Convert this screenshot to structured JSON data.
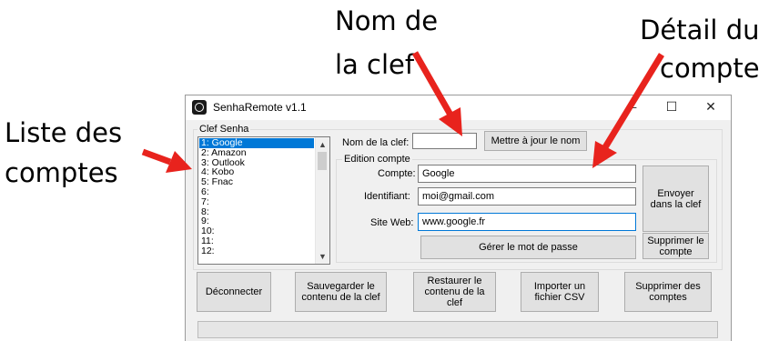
{
  "callouts": {
    "key_name_line1": "Nom de",
    "key_name_line2": "la clef",
    "account_detail_line1": "Détail du",
    "account_detail_line2": "compte",
    "account_list_line1": "Liste des",
    "account_list_line2": "comptes"
  },
  "colors": {
    "arrow": "#e8231d",
    "selection": "#0078d7",
    "window_bg": "#f0f0f0"
  },
  "window": {
    "title": "SenhaRemote v1.1",
    "minimize": "—",
    "maximize": "☐",
    "close": "✕"
  },
  "key_group": {
    "label": "Clef Senha"
  },
  "accounts": [
    "1: Google",
    "2: Amazon",
    "3: Outlook",
    "4: Kobo",
    "5: Fnac",
    "6:",
    "7:",
    "8:",
    "9:",
    "10:",
    "11:",
    "12:"
  ],
  "selected_account_index": 0,
  "key_name": {
    "label": "Nom de la clef:",
    "value": "",
    "update_button": "Mettre à jour le nom"
  },
  "edit_group": {
    "label": "Edition compte",
    "account_label": "Compte:",
    "account_value": "Google",
    "identifier_label": "Identifiant:",
    "identifier_value": "moi@gmail.com",
    "website_label": "Site Web:",
    "website_value": "www.google.fr",
    "send_button": "Envoyer dans la clef",
    "manage_password_button": "Gérer le mot de passe",
    "delete_account_button": "Supprimer le compte"
  },
  "bottom_buttons": {
    "disconnect": "Déconnecter",
    "save": "Sauvegarder le contenu de la clef",
    "restore": "Restaurer le contenu de la clef",
    "import_csv": "Importer un fichier CSV",
    "delete_accounts": "Supprimer des comptes"
  }
}
